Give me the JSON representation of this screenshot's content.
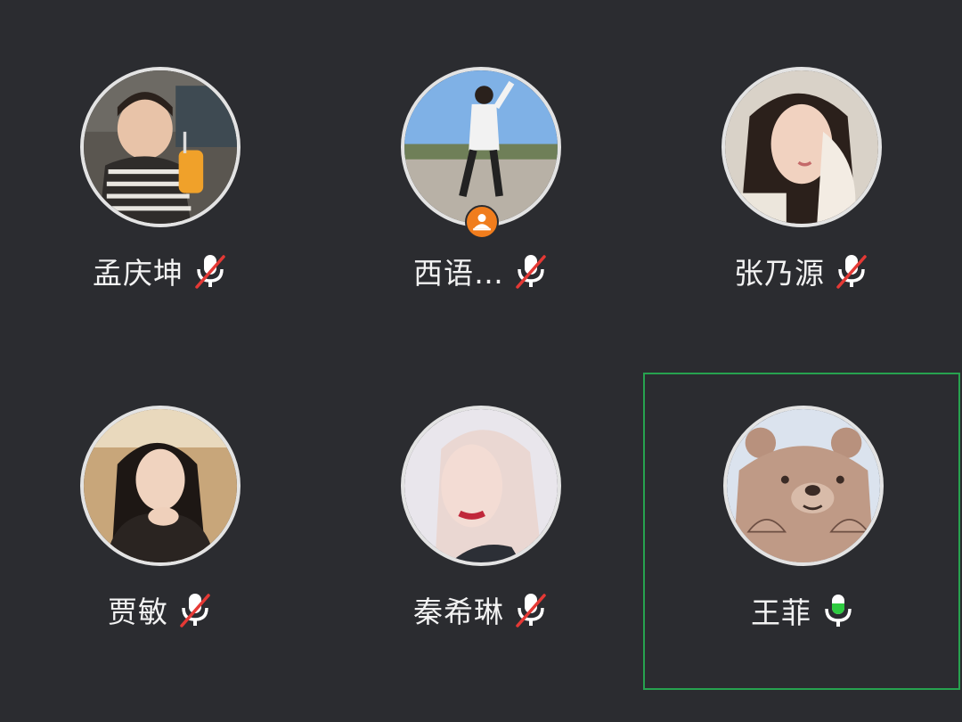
{
  "participants": [
    {
      "name": "孟庆坤",
      "mic": "muted",
      "host": false,
      "active": false
    },
    {
      "name": "西语…",
      "mic": "muted",
      "host": true,
      "active": false
    },
    {
      "name": "张乃源",
      "mic": "muted",
      "host": false,
      "active": false
    },
    {
      "name": "贾敏",
      "mic": "muted",
      "host": false,
      "active": false
    },
    {
      "name": "秦希琳",
      "mic": "muted",
      "host": false,
      "active": false
    },
    {
      "name": "王菲",
      "mic": "speaking",
      "host": false,
      "active": true
    }
  ],
  "icons": {
    "mic_muted": "mic-muted-icon",
    "mic_speaking": "mic-speaking-icon",
    "host_badge": "host-icon"
  },
  "colors": {
    "background": "#2b2c30",
    "active_border": "#27a24f",
    "muted_slash": "#e53935",
    "speaking": "#2ecc40",
    "host_badge": "#f07d1d"
  }
}
